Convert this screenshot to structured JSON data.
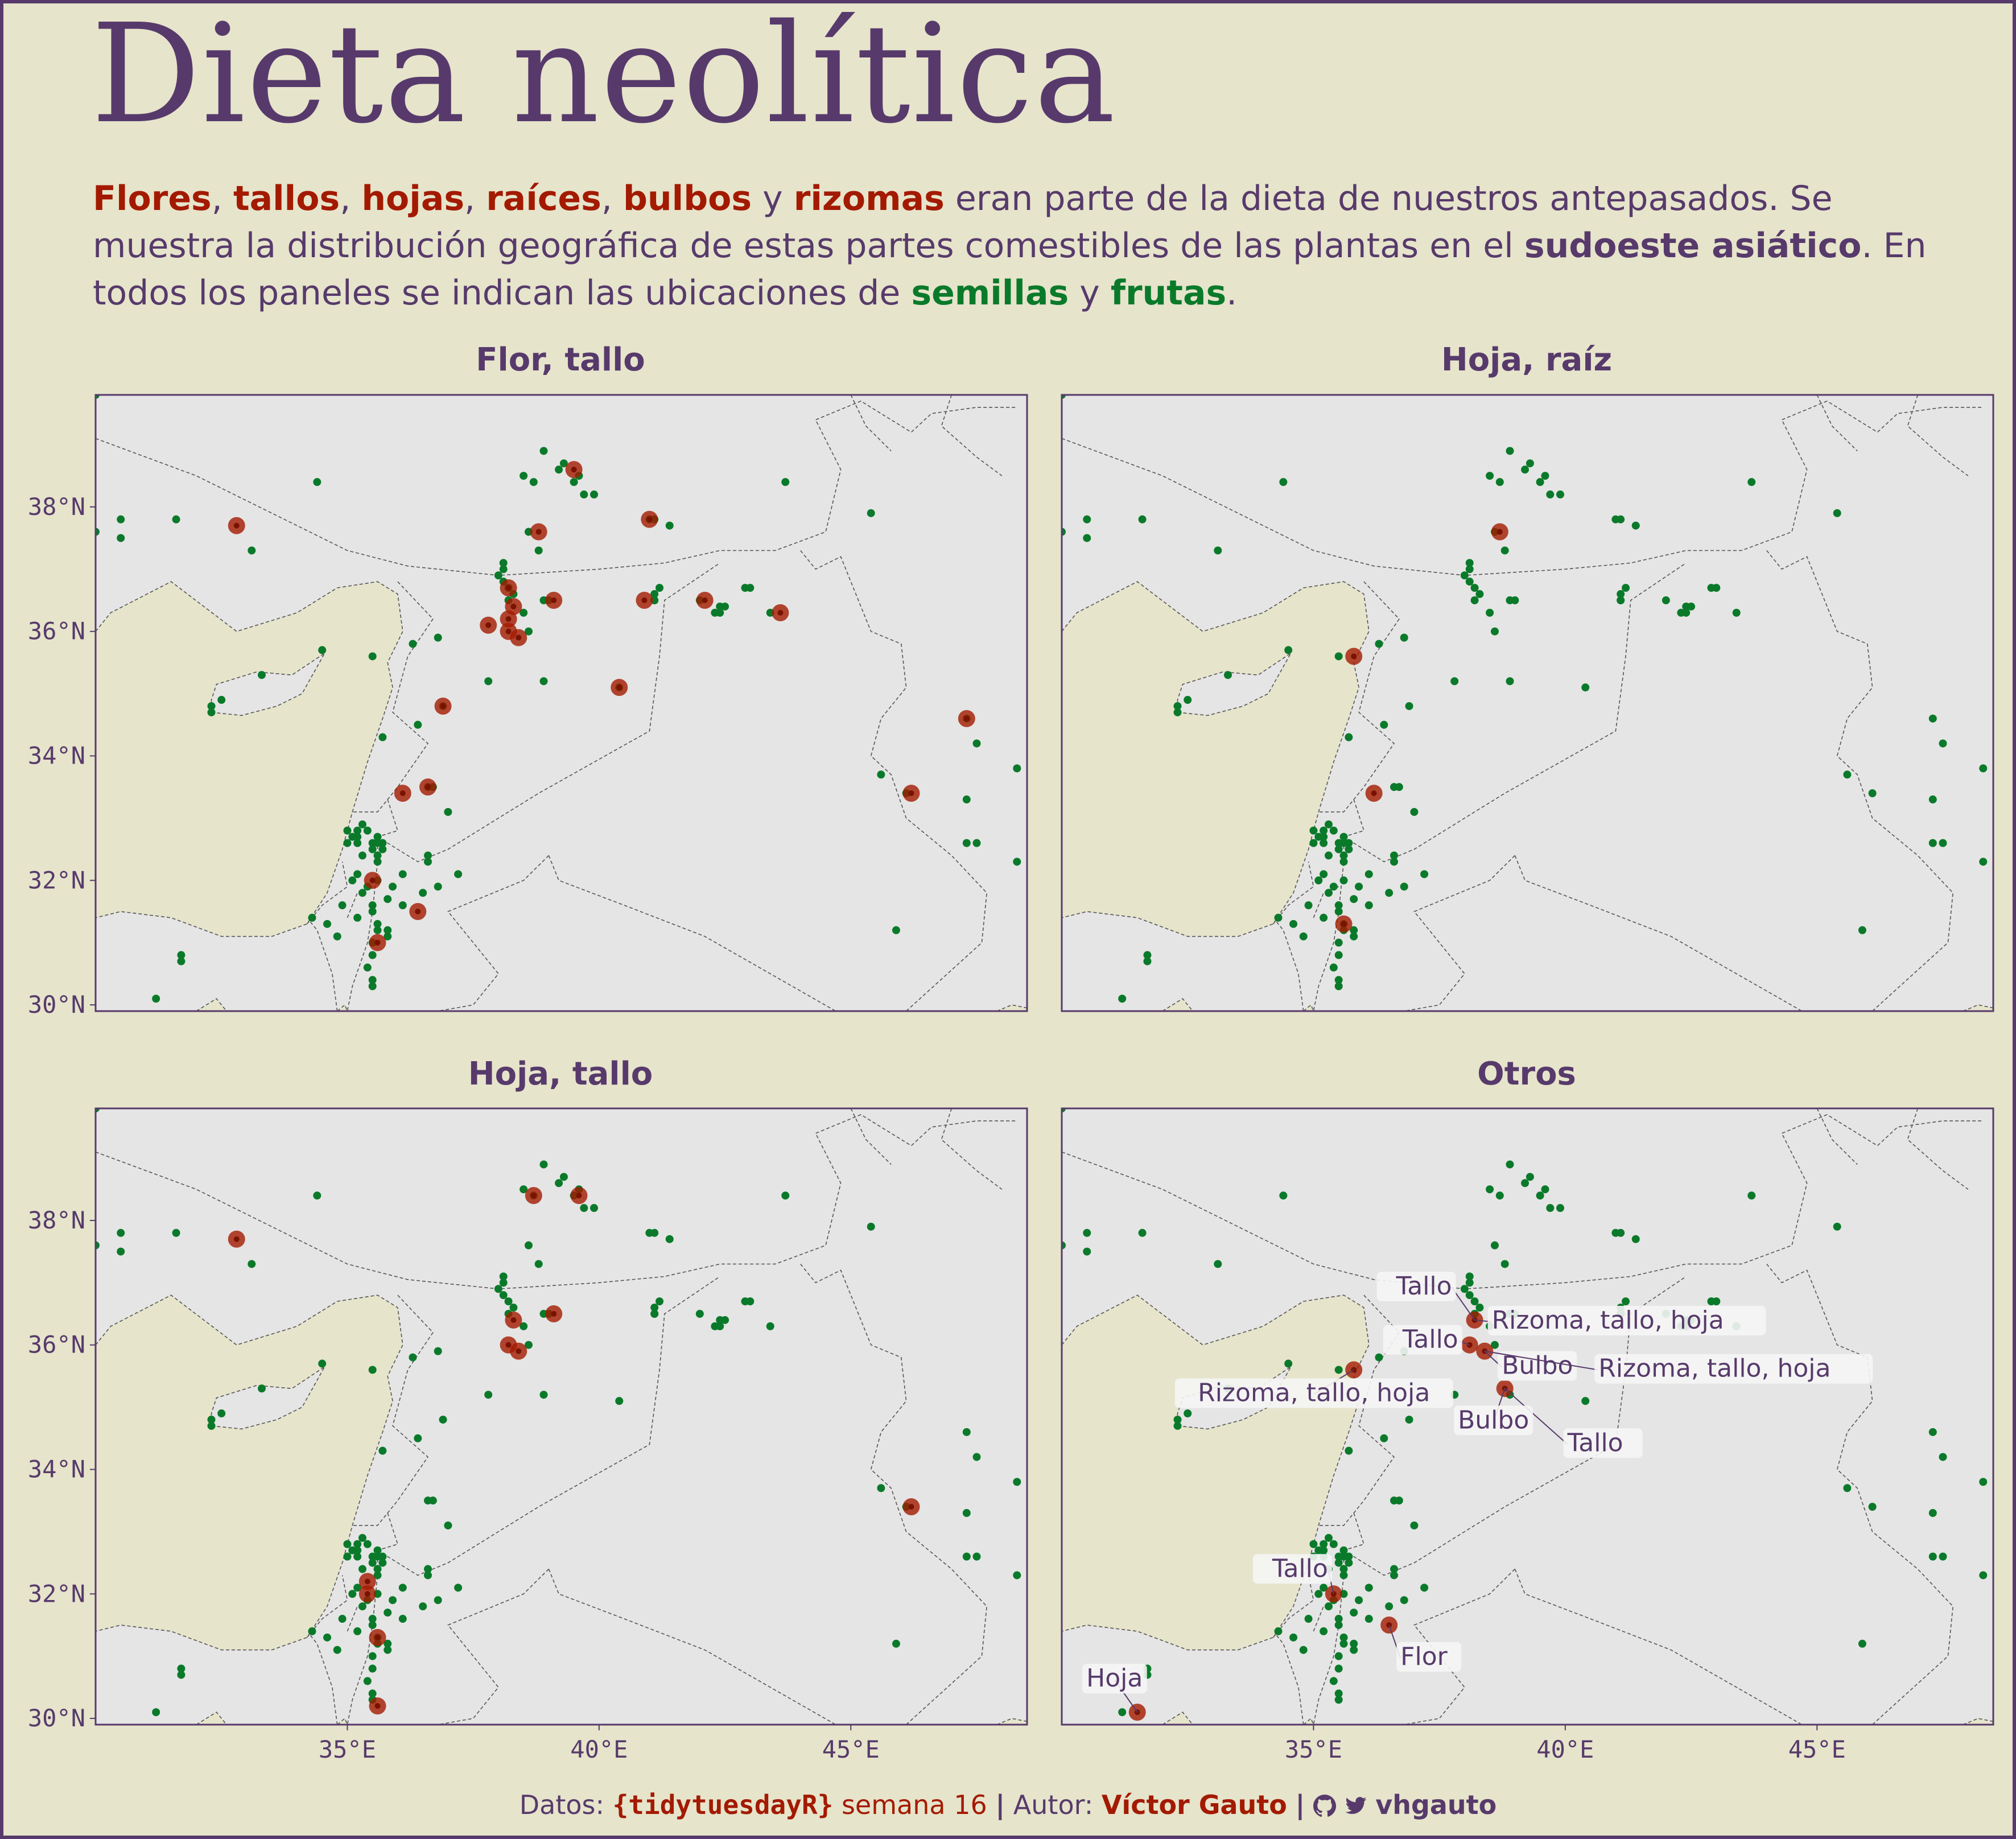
{
  "title": "Dieta neolítica",
  "subtitle": {
    "flores": "Flores",
    "tallos": "tallos",
    "hojas": "hojas",
    "raices": "raíces",
    "bulbos": "bulbos",
    "rizomas": "rizomas",
    "t1": "eran parte de la dieta de nuestros antepasados. Se muestra la distribución geográfica de estas partes comestibles de las plantas en el",
    "region": "sudoeste asiático",
    "t2": ". En todos los paneles se indican las ubicaciones de",
    "semillas": "semillas",
    "frutas": "frutas"
  },
  "colors": {
    "background": "#e6e4cb",
    "map_panel": "#e5e5e5",
    "accent_purple": "#573a6b",
    "highlight_red": "#a31a00",
    "seed_fruit_green": "#0a7a2a",
    "sea": "#e6e4cb"
  },
  "axes": {
    "lon_ticks": [
      "35°E",
      "40°E",
      "45°E"
    ],
    "lat_ticks": [
      "38°N",
      "36°N",
      "34°N",
      "32°N",
      "30°N"
    ],
    "lon_range": [
      30,
      48.5
    ],
    "lat_range": [
      29.9,
      39.8
    ]
  },
  "panels": [
    {
      "title": "Flor, tallo"
    },
    {
      "title": "Hoja, raíz"
    },
    {
      "title": "Hoja, tallo"
    },
    {
      "title": "Otros"
    }
  ],
  "chart_data": {
    "type": "scatter",
    "x_label": "",
    "y_label": "",
    "legend": "none",
    "seeds_fruits": [
      [
        30.0,
        39.8
      ],
      [
        30.0,
        37.6
      ],
      [
        30.5,
        37.8
      ],
      [
        30.5,
        37.5
      ],
      [
        31.6,
        37.8
      ],
      [
        33.1,
        37.3
      ],
      [
        34.4,
        38.4
      ],
      [
        32.3,
        34.8
      ],
      [
        32.3,
        34.7
      ],
      [
        32.5,
        34.9
      ],
      [
        33.3,
        35.3
      ],
      [
        34.5,
        35.7
      ],
      [
        31.2,
        30.1
      ],
      [
        31.7,
        30.8
      ],
      [
        31.7,
        30.7
      ],
      [
        35.5,
        35.6
      ],
      [
        35.7,
        34.3
      ],
      [
        36.3,
        35.8
      ],
      [
        36.8,
        35.9
      ],
      [
        36.4,
        34.5
      ],
      [
        36.9,
        34.8
      ],
      [
        36.6,
        33.5
      ],
      [
        36.7,
        33.5
      ],
      [
        37.0,
        33.1
      ],
      [
        37.8,
        35.2
      ],
      [
        38.0,
        36.9
      ],
      [
        38.1,
        37.0
      ],
      [
        38.1,
        37.1
      ],
      [
        38.1,
        36.8
      ],
      [
        38.3,
        36.6
      ],
      [
        38.5,
        36.3
      ],
      [
        38.2,
        36.5
      ],
      [
        38.2,
        36.7
      ],
      [
        38.6,
        36.0
      ],
      [
        38.9,
        35.2
      ],
      [
        38.9,
        36.5
      ],
      [
        39.0,
        36.5
      ],
      [
        38.8,
        37.3
      ],
      [
        38.6,
        37.6
      ],
      [
        38.5,
        38.5
      ],
      [
        38.7,
        38.4
      ],
      [
        38.9,
        38.9
      ],
      [
        39.2,
        38.6
      ],
      [
        39.3,
        38.7
      ],
      [
        39.5,
        38.4
      ],
      [
        39.6,
        38.5
      ],
      [
        39.7,
        38.2
      ],
      [
        39.9,
        38.2
      ],
      [
        41.0,
        37.8
      ],
      [
        41.1,
        37.8
      ],
      [
        41.4,
        37.7
      ],
      [
        40.4,
        35.1
      ],
      [
        41.1,
        36.5
      ],
      [
        41.1,
        36.5
      ],
      [
        41.1,
        36.6
      ],
      [
        41.2,
        36.7
      ],
      [
        42.0,
        36.5
      ],
      [
        42.3,
        36.3
      ],
      [
        42.4,
        36.3
      ],
      [
        42.4,
        36.4
      ],
      [
        42.5,
        36.4
      ],
      [
        42.9,
        36.7
      ],
      [
        43.0,
        36.7
      ],
      [
        43.4,
        36.3
      ],
      [
        43.7,
        38.4
      ],
      [
        45.4,
        37.9
      ],
      [
        45.6,
        33.7
      ],
      [
        45.9,
        31.2
      ],
      [
        46.1,
        33.4
      ],
      [
        47.3,
        34.6
      ],
      [
        47.5,
        34.2
      ],
      [
        47.3,
        33.3
      ],
      [
        47.3,
        32.6
      ],
      [
        47.5,
        32.6
      ],
      [
        48.3,
        33.8
      ],
      [
        48.3,
        32.3
      ],
      [
        48.6,
        32.2
      ],
      [
        48.6,
        32.2
      ],
      [
        35.0,
        32.8
      ],
      [
        35.0,
        32.6
      ],
      [
        35.1,
        32.7
      ],
      [
        35.2,
        32.7
      ],
      [
        35.2,
        32.6
      ],
      [
        35.2,
        32.8
      ],
      [
        35.3,
        32.9
      ],
      [
        35.4,
        32.8
      ],
      [
        35.5,
        32.5
      ],
      [
        35.5,
        32.6
      ],
      [
        35.6,
        32.7
      ],
      [
        35.6,
        32.4
      ],
      [
        35.6,
        32.3
      ],
      [
        35.7,
        32.6
      ],
      [
        35.7,
        32.5
      ],
      [
        35.6,
        32.6
      ],
      [
        35.3,
        32.4
      ],
      [
        35.2,
        32.1
      ],
      [
        35.1,
        32.0
      ],
      [
        35.3,
        31.8
      ],
      [
        35.4,
        31.9
      ],
      [
        35.6,
        32.0
      ],
      [
        35.9,
        31.9
      ],
      [
        36.1,
        32.1
      ],
      [
        36.6,
        32.4
      ],
      [
        36.5,
        31.8
      ],
      [
        36.8,
        31.9
      ],
      [
        37.2,
        32.1
      ],
      [
        35.8,
        31.7
      ],
      [
        35.5,
        31.6
      ],
      [
        35.5,
        31.5
      ],
      [
        35.6,
        31.3
      ],
      [
        35.6,
        31.2
      ],
      [
        35.5,
        31.0
      ],
      [
        35.5,
        30.8
      ],
      [
        35.4,
        30.6
      ],
      [
        35.5,
        30.4
      ],
      [
        35.5,
        30.3
      ],
      [
        34.9,
        31.6
      ],
      [
        35.2,
        31.4
      ],
      [
        34.8,
        31.1
      ],
      [
        34.6,
        31.3
      ],
      [
        35.8,
        31.1
      ],
      [
        35.8,
        31.2
      ],
      [
        36.1,
        31.6
      ],
      [
        34.3,
        31.4
      ],
      [
        36.6,
        32.3
      ]
    ],
    "series": [
      {
        "name": "Flor, tallo",
        "points": [
          [
            32.8,
            37.7
          ],
          [
            38.8,
            37.6
          ],
          [
            39.5,
            38.6
          ],
          [
            41.0,
            37.8
          ],
          [
            38.2,
            36.7
          ],
          [
            38.3,
            36.4
          ],
          [
            38.2,
            36.2
          ],
          [
            37.8,
            36.1
          ],
          [
            38.2,
            36.0
          ],
          [
            38.4,
            35.9
          ],
          [
            39.1,
            36.5
          ],
          [
            40.9,
            36.5
          ],
          [
            42.1,
            36.5
          ],
          [
            43.6,
            36.3
          ],
          [
            40.4,
            35.1
          ],
          [
            36.9,
            34.8
          ],
          [
            36.1,
            33.4
          ],
          [
            36.6,
            33.5
          ],
          [
            35.5,
            32.0
          ],
          [
            36.4,
            31.5
          ],
          [
            35.6,
            31.0
          ],
          [
            47.3,
            34.6
          ],
          [
            46.2,
            33.4
          ]
        ]
      },
      {
        "name": "Hoja, raíz",
        "points": [
          [
            38.7,
            37.6
          ],
          [
            35.8,
            35.6
          ],
          [
            36.2,
            33.4
          ],
          [
            35.6,
            31.3
          ]
        ]
      },
      {
        "name": "Hoja, tallo",
        "points": [
          [
            32.8,
            37.7
          ],
          [
            38.7,
            38.4
          ],
          [
            39.6,
            38.4
          ],
          [
            38.3,
            36.4
          ],
          [
            39.1,
            36.5
          ],
          [
            38.2,
            36.0
          ],
          [
            38.4,
            35.9
          ],
          [
            35.4,
            32.2
          ],
          [
            35.4,
            32.0
          ],
          [
            35.6,
            31.3
          ],
          [
            35.6,
            30.2
          ],
          [
            46.2,
            33.4
          ]
        ]
      },
      {
        "name": "Otros",
        "points": [
          {
            "lon": 38.2,
            "lat": 36.4,
            "label": "Tallo"
          },
          {
            "lon": 38.2,
            "lat": 36.4,
            "label": "Rizoma, tallo, hoja"
          },
          {
            "lon": 38.1,
            "lat": 36.0,
            "label": "Tallo"
          },
          {
            "lon": 38.4,
            "lat": 35.9,
            "label": "Bulbo"
          },
          {
            "lon": 38.4,
            "lat": 35.9,
            "label": "Rizoma, tallo, hoja"
          },
          {
            "lon": 38.8,
            "lat": 35.3,
            "label": "Tallo"
          },
          {
            "lon": 38.8,
            "lat": 35.3,
            "label": "Bulbo"
          },
          {
            "lon": 35.8,
            "lat": 35.6,
            "label": "Rizoma, tallo, hoja"
          },
          {
            "lon": 35.4,
            "lat": 32.0,
            "label": "Tallo"
          },
          {
            "lon": 36.5,
            "lat": 31.5,
            "label": "Flor"
          },
          {
            "lon": 31.5,
            "lat": 30.1,
            "label": "Hoja"
          }
        ]
      }
    ]
  },
  "footer": {
    "datos": "Datos:",
    "pkg": "{tidytuesdayR}",
    "week": "semana 16",
    "sep1": "|",
    "autor": "Autor:",
    "author_name": "Víctor Gauto",
    "sep2": "|",
    "github_icon": "github-icon",
    "twitter_icon": "twitter-icon",
    "handle": "vhgauto"
  }
}
